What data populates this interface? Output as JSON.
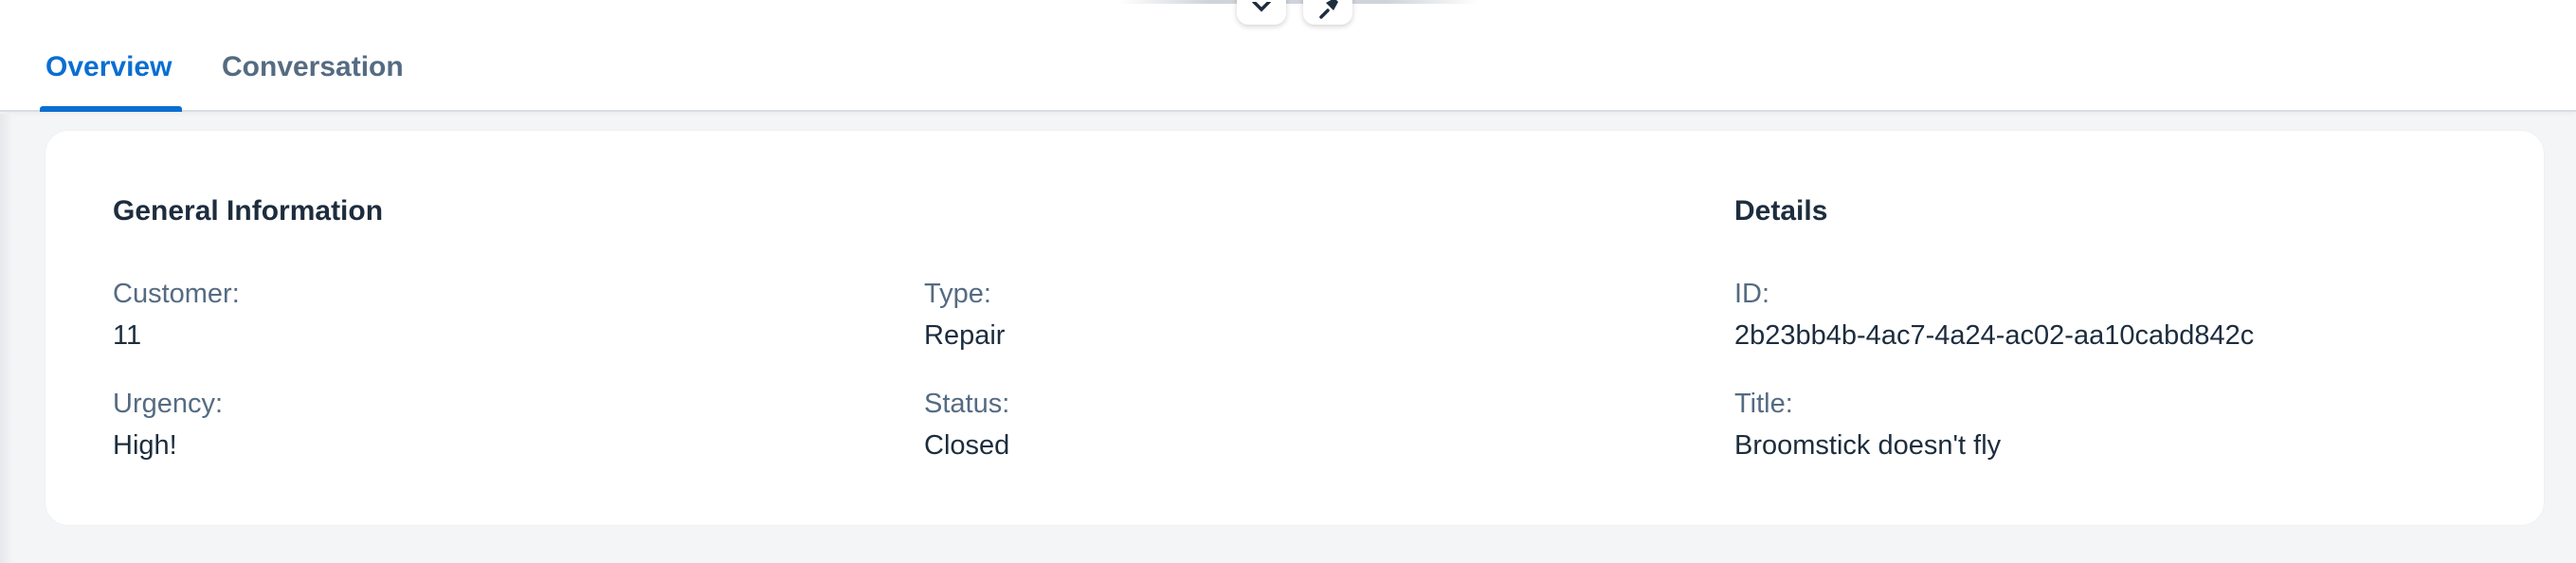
{
  "tabs": [
    {
      "label": "Overview",
      "active": true
    },
    {
      "label": "Conversation",
      "active": false
    }
  ],
  "floating_buttons": [
    {
      "icon": "close-icon"
    },
    {
      "icon": "pin-icon"
    }
  ],
  "general_information": {
    "title": "General Information",
    "customer": {
      "label": "Customer:",
      "value": "11"
    },
    "urgency": {
      "label": "Urgency:",
      "value": "High!"
    },
    "type": {
      "label": "Type:",
      "value": "Repair"
    },
    "status": {
      "label": "Status:",
      "value": "Closed"
    }
  },
  "details": {
    "title": "Details",
    "id": {
      "label": "ID:",
      "value": "2b23bb4b-4ac7-4a24-ac02-aa10cabd842c"
    },
    "item_title": {
      "label": "Title:",
      "value": "Broomstick doesn't fly"
    }
  },
  "colors": {
    "accent": "#0a6ed1",
    "label": "#556b82",
    "text": "#1d2d3e",
    "background": "#f4f5f6"
  }
}
